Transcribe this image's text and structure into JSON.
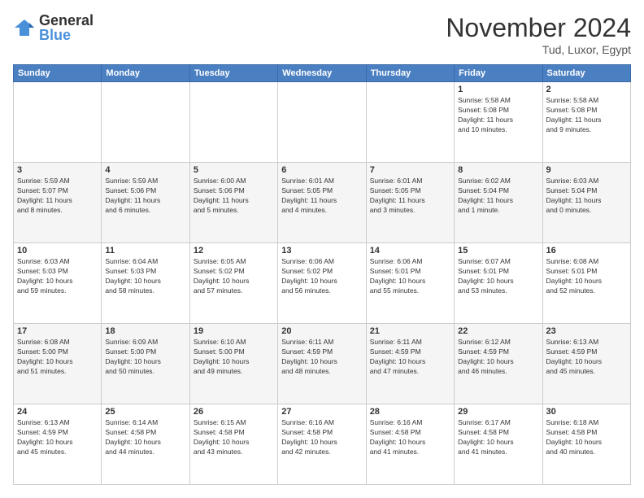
{
  "logo": {
    "general": "General",
    "blue": "Blue"
  },
  "header": {
    "month": "November 2024",
    "location": "Tud, Luxor, Egypt"
  },
  "days": [
    "Sunday",
    "Monday",
    "Tuesday",
    "Wednesday",
    "Thursday",
    "Friday",
    "Saturday"
  ],
  "weeks": [
    [
      {
        "day": "",
        "info": ""
      },
      {
        "day": "",
        "info": ""
      },
      {
        "day": "",
        "info": ""
      },
      {
        "day": "",
        "info": ""
      },
      {
        "day": "",
        "info": ""
      },
      {
        "day": "1",
        "info": "Sunrise: 5:58 AM\nSunset: 5:08 PM\nDaylight: 11 hours\nand 10 minutes."
      },
      {
        "day": "2",
        "info": "Sunrise: 5:58 AM\nSunset: 5:08 PM\nDaylight: 11 hours\nand 9 minutes."
      }
    ],
    [
      {
        "day": "3",
        "info": "Sunrise: 5:59 AM\nSunset: 5:07 PM\nDaylight: 11 hours\nand 8 minutes."
      },
      {
        "day": "4",
        "info": "Sunrise: 5:59 AM\nSunset: 5:06 PM\nDaylight: 11 hours\nand 6 minutes."
      },
      {
        "day": "5",
        "info": "Sunrise: 6:00 AM\nSunset: 5:06 PM\nDaylight: 11 hours\nand 5 minutes."
      },
      {
        "day": "6",
        "info": "Sunrise: 6:01 AM\nSunset: 5:05 PM\nDaylight: 11 hours\nand 4 minutes."
      },
      {
        "day": "7",
        "info": "Sunrise: 6:01 AM\nSunset: 5:05 PM\nDaylight: 11 hours\nand 3 minutes."
      },
      {
        "day": "8",
        "info": "Sunrise: 6:02 AM\nSunset: 5:04 PM\nDaylight: 11 hours\nand 1 minute."
      },
      {
        "day": "9",
        "info": "Sunrise: 6:03 AM\nSunset: 5:04 PM\nDaylight: 11 hours\nand 0 minutes."
      }
    ],
    [
      {
        "day": "10",
        "info": "Sunrise: 6:03 AM\nSunset: 5:03 PM\nDaylight: 10 hours\nand 59 minutes."
      },
      {
        "day": "11",
        "info": "Sunrise: 6:04 AM\nSunset: 5:03 PM\nDaylight: 10 hours\nand 58 minutes."
      },
      {
        "day": "12",
        "info": "Sunrise: 6:05 AM\nSunset: 5:02 PM\nDaylight: 10 hours\nand 57 minutes."
      },
      {
        "day": "13",
        "info": "Sunrise: 6:06 AM\nSunset: 5:02 PM\nDaylight: 10 hours\nand 56 minutes."
      },
      {
        "day": "14",
        "info": "Sunrise: 6:06 AM\nSunset: 5:01 PM\nDaylight: 10 hours\nand 55 minutes."
      },
      {
        "day": "15",
        "info": "Sunrise: 6:07 AM\nSunset: 5:01 PM\nDaylight: 10 hours\nand 53 minutes."
      },
      {
        "day": "16",
        "info": "Sunrise: 6:08 AM\nSunset: 5:01 PM\nDaylight: 10 hours\nand 52 minutes."
      }
    ],
    [
      {
        "day": "17",
        "info": "Sunrise: 6:08 AM\nSunset: 5:00 PM\nDaylight: 10 hours\nand 51 minutes."
      },
      {
        "day": "18",
        "info": "Sunrise: 6:09 AM\nSunset: 5:00 PM\nDaylight: 10 hours\nand 50 minutes."
      },
      {
        "day": "19",
        "info": "Sunrise: 6:10 AM\nSunset: 5:00 PM\nDaylight: 10 hours\nand 49 minutes."
      },
      {
        "day": "20",
        "info": "Sunrise: 6:11 AM\nSunset: 4:59 PM\nDaylight: 10 hours\nand 48 minutes."
      },
      {
        "day": "21",
        "info": "Sunrise: 6:11 AM\nSunset: 4:59 PM\nDaylight: 10 hours\nand 47 minutes."
      },
      {
        "day": "22",
        "info": "Sunrise: 6:12 AM\nSunset: 4:59 PM\nDaylight: 10 hours\nand 46 minutes."
      },
      {
        "day": "23",
        "info": "Sunrise: 6:13 AM\nSunset: 4:59 PM\nDaylight: 10 hours\nand 45 minutes."
      }
    ],
    [
      {
        "day": "24",
        "info": "Sunrise: 6:13 AM\nSunset: 4:59 PM\nDaylight: 10 hours\nand 45 minutes."
      },
      {
        "day": "25",
        "info": "Sunrise: 6:14 AM\nSunset: 4:58 PM\nDaylight: 10 hours\nand 44 minutes."
      },
      {
        "day": "26",
        "info": "Sunrise: 6:15 AM\nSunset: 4:58 PM\nDaylight: 10 hours\nand 43 minutes."
      },
      {
        "day": "27",
        "info": "Sunrise: 6:16 AM\nSunset: 4:58 PM\nDaylight: 10 hours\nand 42 minutes."
      },
      {
        "day": "28",
        "info": "Sunrise: 6:16 AM\nSunset: 4:58 PM\nDaylight: 10 hours\nand 41 minutes."
      },
      {
        "day": "29",
        "info": "Sunrise: 6:17 AM\nSunset: 4:58 PM\nDaylight: 10 hours\nand 41 minutes."
      },
      {
        "day": "30",
        "info": "Sunrise: 6:18 AM\nSunset: 4:58 PM\nDaylight: 10 hours\nand 40 minutes."
      }
    ]
  ]
}
